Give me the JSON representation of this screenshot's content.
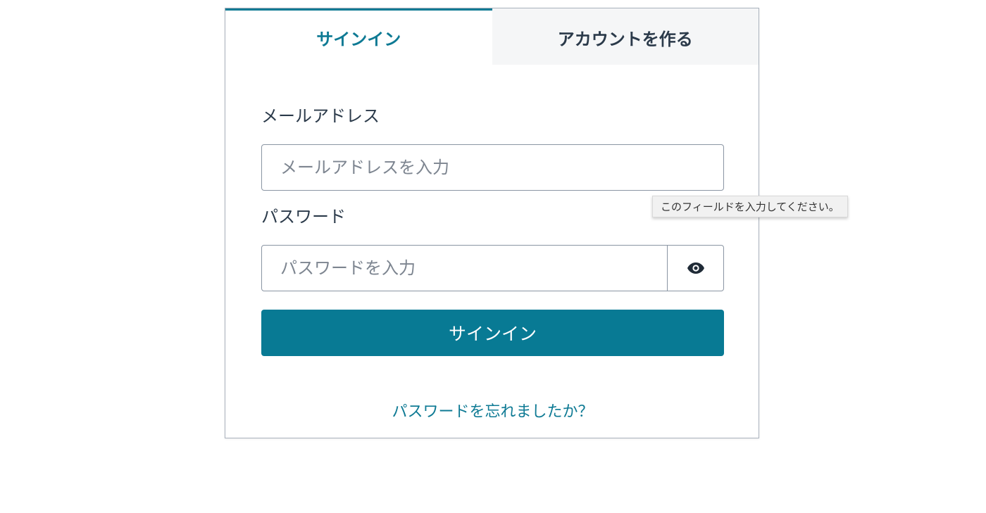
{
  "tabs": {
    "signin_label": "サインイン",
    "create_account_label": "アカウントを作る",
    "active": "signin"
  },
  "form": {
    "email_label": "メールアドレス",
    "email_placeholder": "メールアドレスを入力",
    "email_value": "",
    "password_label": "パスワード",
    "password_placeholder": "パスワードを入力",
    "password_value": "",
    "show_password_icon": "eye-icon",
    "submit_label": "サインイン",
    "forgot_password_label": "パスワードを忘れましたか？"
  },
  "tooltip": {
    "text": "このフィールドを入力してください。"
  },
  "colors": {
    "accent": "#087a94",
    "text": "#2b3a4a",
    "inactive_tab_bg": "#f5f6f7"
  }
}
